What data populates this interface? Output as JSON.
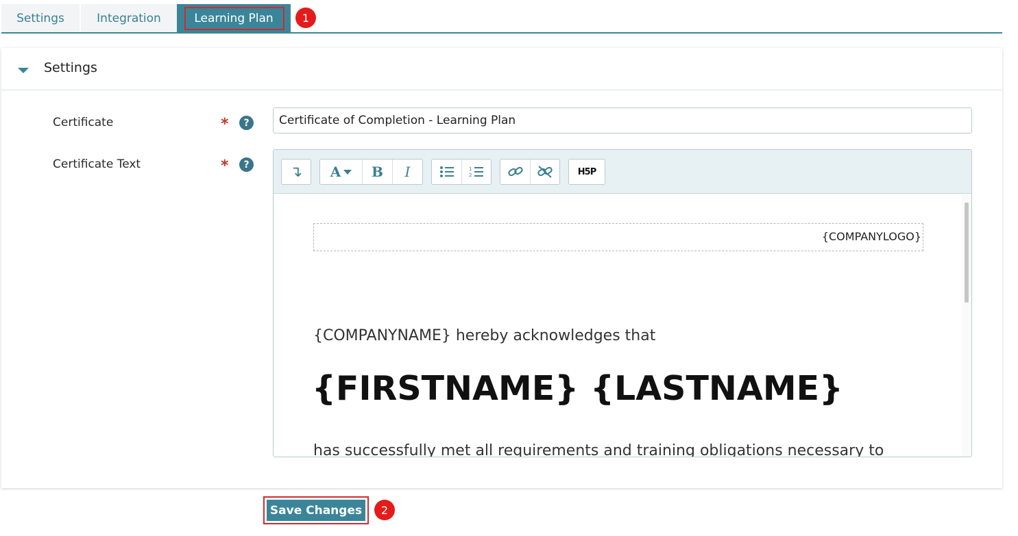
{
  "tabs": [
    {
      "label": "Settings"
    },
    {
      "label": "Integration"
    },
    {
      "label": "Learning Plan",
      "active": true
    }
  ],
  "annotations": {
    "one": "1",
    "two": "2"
  },
  "panel": {
    "title": "Settings",
    "fields": {
      "certificate": {
        "label": "Certificate",
        "required": "*",
        "help": "?",
        "value": "Certificate of Completion - Learning Plan"
      },
      "certificate_text": {
        "label": "Certificate Text",
        "required": "*",
        "help": "?"
      }
    }
  },
  "editor": {
    "toolbar": {
      "insert_icon": "↴",
      "font_icon": "A",
      "bold": "B",
      "italic": "I",
      "h5p_label": "H5P"
    },
    "content": {
      "logo_placeholder": "{COMPANYLOGO}",
      "line1": "{COMPANYNAME} hereby acknowledges that",
      "names": "{FIRSTNAME} {LASTNAME}",
      "line2": "has successfully met all requirements and training obligations necessary to"
    }
  },
  "save_button": {
    "label": "Save Changes"
  },
  "colors": {
    "accent": "#3a8599",
    "highlight": "#d22a2a",
    "badge": "#e41b1b"
  }
}
